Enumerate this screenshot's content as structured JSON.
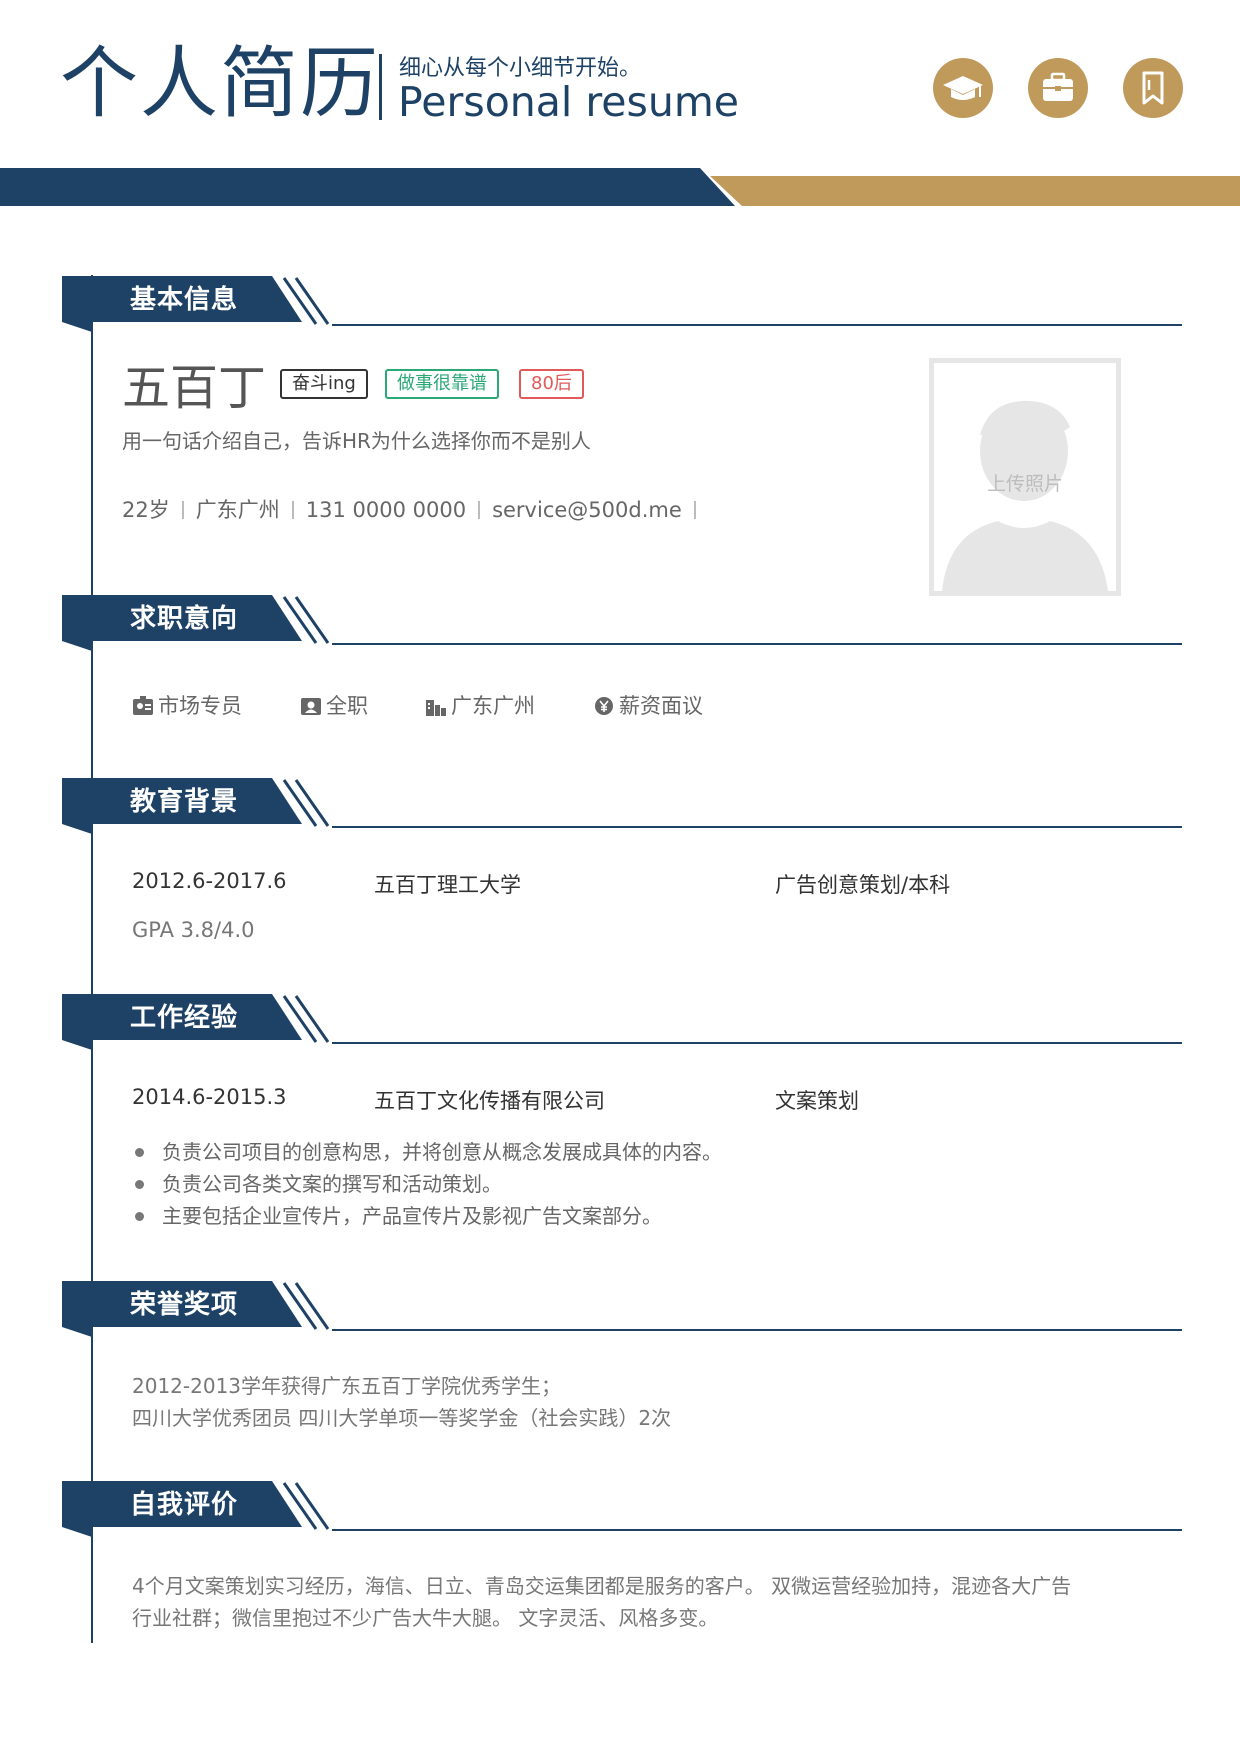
{
  "header": {
    "title_cn": "个人简历",
    "slogan": "细心从每个小细节开始。",
    "title_en": "Personal resume",
    "icons": [
      "graduation-cap-icon",
      "briefcase-icon",
      "bookmark-icon"
    ]
  },
  "colors": {
    "navy": "#1e4266",
    "gold": "#c09a5b"
  },
  "sections": {
    "basic": "基本信息",
    "intent": "求职意向",
    "education": "教育背景",
    "work": "工作经验",
    "honors": "荣誉奖项",
    "self": "自我评价"
  },
  "basic": {
    "name": "五百丁",
    "tags": [
      "奋斗ing",
      "做事很靠谱",
      "80后"
    ],
    "intro": "用一句话介绍自己，告诉HR为什么选择你而不是别人",
    "age": "22岁",
    "location": "广东广州",
    "phone": "131 0000 0000",
    "email": "service@500d.me",
    "photo_label": "上传照片"
  },
  "intent": {
    "position": "市场专员",
    "type": "全职",
    "city": "广东广州",
    "salary": "薪资面议"
  },
  "education": {
    "period": "2012.6-2017.6",
    "school": "五百丁理工大学",
    "major": "广告创意策划/本科",
    "gpa": "GPA 3.8/4.0"
  },
  "work": {
    "period": "2014.6-2015.3",
    "company": "五百丁文化传播有限公司",
    "role": "文案策划",
    "duties": [
      "负责公司项目的创意构思，并将创意从概念发展成具体的内容。",
      "负责公司各类文案的撰写和活动策划。",
      "主要包括企业宣传片，产品宣传片及影视广告文案部分。"
    ]
  },
  "honors": {
    "line1": "2012-2013学年获得广东五百丁学院优秀学生；",
    "line2": "四川大学优秀团员 四川大学单项一等奖学金（社会实践）2次"
  },
  "self_eval": {
    "line1": "4个月文案策划实习经历，海信、日立、青岛交运集团都是服务的客户。 双微运营经验加持，混迹各大广告",
    "line2": "行业社群；微信里抱过不少广告大牛大腿。 文字灵活、风格多变。"
  }
}
